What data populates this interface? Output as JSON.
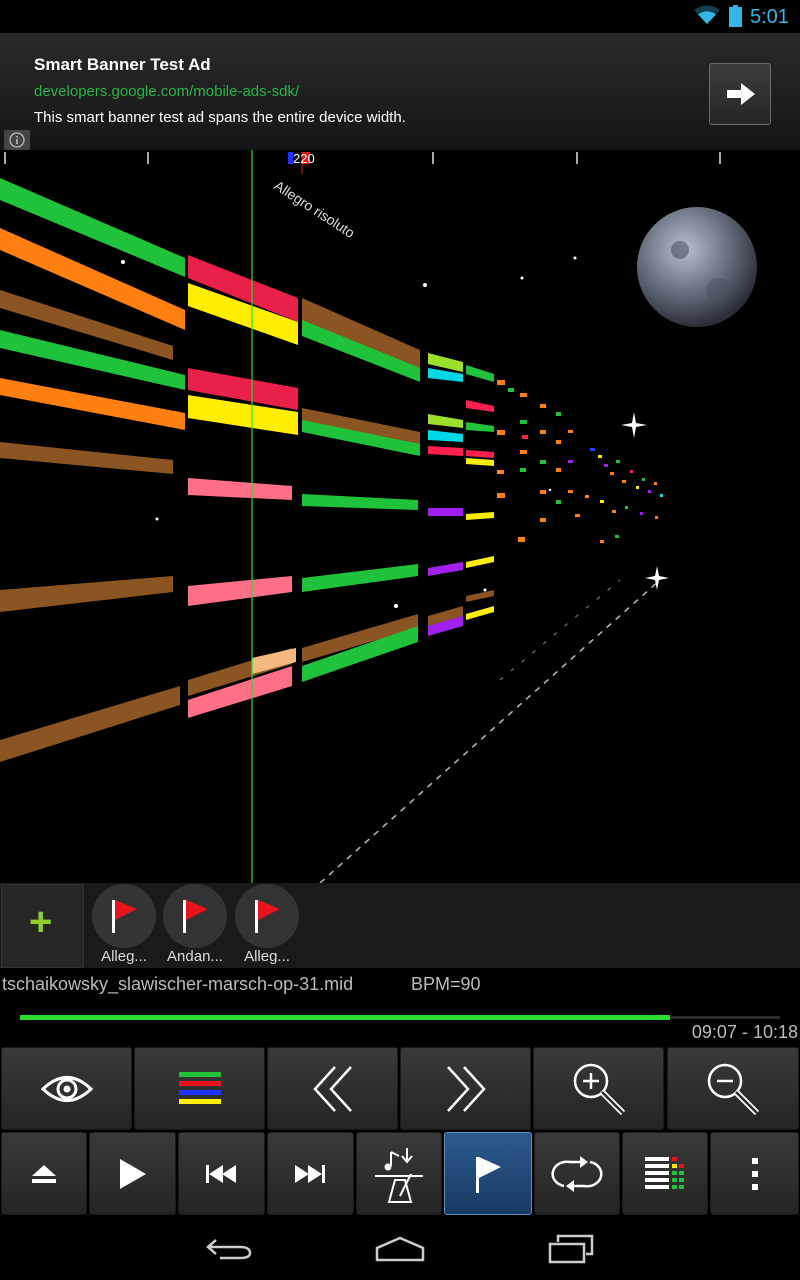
{
  "status_bar": {
    "time": "5:01"
  },
  "ad": {
    "title": "Smart Banner Test Ad",
    "url": "developers.google.com/mobile-ads-sdk/",
    "text": "This smart banner test ad spans the entire device width."
  },
  "visualizer": {
    "measure_label": "220",
    "tempo_label": "Allegro risoluto"
  },
  "markers": {
    "items": [
      {
        "label": "Alleg..."
      },
      {
        "label": "Andan..."
      },
      {
        "label": "Alleg..."
      }
    ]
  },
  "file_info": {
    "filename": "tschaikowsky_slawischer-marsch-op-31.mid",
    "bpm": "BPM=90",
    "times": "09:07 - 10:18",
    "progress": 0.8553
  },
  "toolbar_top": {
    "buttons": [
      "eye-icon",
      "tracks-colors-icon",
      "rewind-chevron-icon",
      "forward-chevron-icon",
      "zoom-in-icon",
      "zoom-out-icon"
    ]
  },
  "toolbar_bottom": {
    "buttons": [
      "eject-icon",
      "play-icon",
      "skip-back-icon",
      "skip-forward-icon",
      "metronome-icon",
      "flag-icon",
      "loop-icon",
      "mixer-icon",
      "more-icon"
    ]
  },
  "colors": {
    "accent": "#33b5e5",
    "progress": "#2bdc2b",
    "active_button": "#2d5a8e",
    "marker_flag": "#e8141c"
  }
}
